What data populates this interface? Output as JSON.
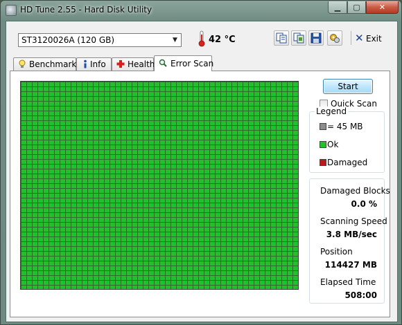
{
  "window": {
    "title": "HD Tune 2.55 - Hard Disk Utility"
  },
  "controls": {
    "minimize_icon": "minimize-icon",
    "maximize_icon": "maximize-icon",
    "close_icon": "close-icon"
  },
  "toolbar": {
    "drive": "ST3120026A (120 GB)",
    "temperature": "42 °C",
    "exit_label": "Exit",
    "icons": [
      "copy-text-icon",
      "copy-screenshot-icon",
      "save-icon",
      "options-icon",
      "exit-icon"
    ]
  },
  "tabs": [
    {
      "label": "Benchmark",
      "icon": "benchmark-bulb-icon"
    },
    {
      "label": "Info",
      "icon": "info-icon"
    },
    {
      "label": "Health",
      "icon": "health-cross-icon"
    },
    {
      "label": "Error Scan",
      "icon": "magnifier-icon",
      "active": true
    }
  ],
  "scan": {
    "start_label": "Start",
    "quick_scan_label": "Quick Scan",
    "quick_scan_checked": false,
    "block_status": "ok",
    "legend": {
      "title": "Legend",
      "items": [
        {
          "label": "= 45 MB",
          "color": "#8c8c8c"
        },
        {
          "label": "Ok",
          "color": "#1fc22a"
        },
        {
          "label": "Damaged",
          "color": "#c2151c"
        }
      ]
    },
    "stats": [
      {
        "label": "Damaged Blocks",
        "value": "0.0 %"
      },
      {
        "label": "Scanning Speed",
        "value": "3.8 MB/sec"
      },
      {
        "label": "Position",
        "value": "114427 MB"
      },
      {
        "label": "Elapsed Time",
        "value": "508:00"
      }
    ]
  },
  "colors": {
    "ok": "#1fc22a",
    "damaged": "#c2151c",
    "accent": "#3c7fb1"
  }
}
